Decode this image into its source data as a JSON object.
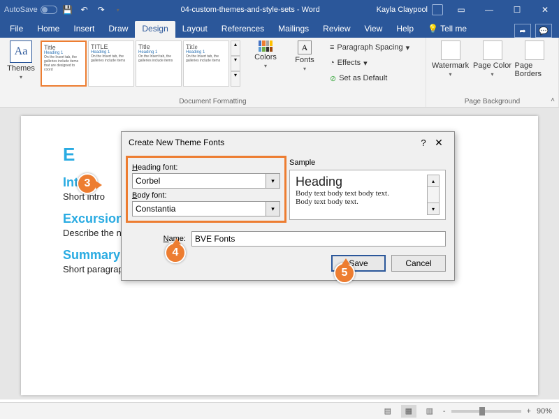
{
  "titlebar": {
    "autosave": "AutoSave",
    "doc_title": "04-custom-themes-and-style-sets - Word",
    "user": "Kayla Claypool"
  },
  "tabs": {
    "file": "File",
    "home": "Home",
    "insert": "Insert",
    "draw": "Draw",
    "design": "Design",
    "layout": "Layout",
    "references": "References",
    "mailings": "Mailings",
    "review": "Review",
    "view": "View",
    "help": "Help",
    "tellme": "Tell me"
  },
  "ribbon": {
    "themes": "Themes",
    "colors": "Colors",
    "fonts": "Fonts",
    "para_spacing": "Paragraph Spacing",
    "effects": "Effects",
    "set_default": "Set as Default",
    "watermark": "Watermark",
    "page_color": "Page Color",
    "page_borders": "Page Borders",
    "group_docfmt": "Document Formatting",
    "group_pagebg": "Page Background",
    "tiles": [
      {
        "title": "Title",
        "h1": "Heading 1"
      },
      {
        "title": "TITLE",
        "h1": "Heading 1"
      },
      {
        "title": "Title",
        "h1": "Heading 1"
      },
      {
        "title": "Title",
        "h1": "Heading 1"
      }
    ]
  },
  "page": {
    "title": "Excursion",
    "h_intro": "Intro",
    "p_intro": "Short intro",
    "h_desc": "Excursion Description",
    "p_desc": "Describe the new excursion",
    "h_sum": "Summary",
    "p_sum": "Short paragraph to summarize"
  },
  "dialog": {
    "title": "Create New Theme Fonts",
    "heading_font_label": "Heading font:",
    "heading_font": "Corbel",
    "body_font_label": "Body font:",
    "body_font": "Constantia",
    "sample_label": "Sample",
    "sample_heading": "Heading",
    "sample_body1": "Body text body text body text.",
    "sample_body2": "Body text body text.",
    "name_label": "Name:",
    "name_value": "BVE Fonts",
    "save": "Save",
    "cancel": "Cancel"
  },
  "badges": {
    "b3": "3",
    "b4": "4",
    "b5": "5"
  },
  "status": {
    "zoom": "90%",
    "minus": "-",
    "plus": "+"
  }
}
